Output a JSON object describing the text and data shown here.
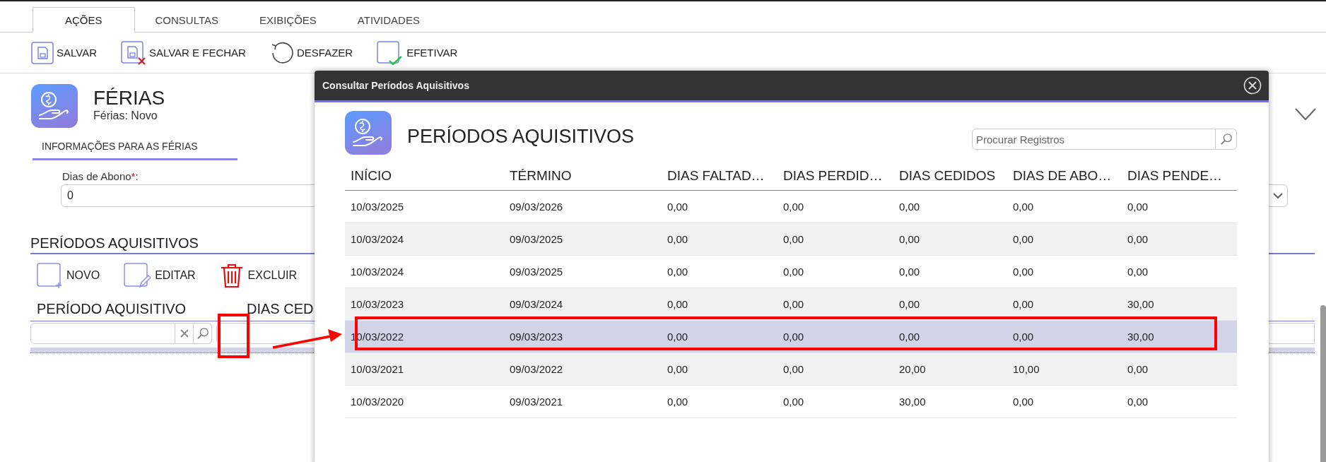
{
  "tabs": [
    {
      "label": "AÇÕES",
      "selected": true
    },
    {
      "label": "CONSULTAS",
      "selected": false
    },
    {
      "label": "EXIBIÇÕES",
      "selected": false
    },
    {
      "label": "ATIVIDADES",
      "selected": false
    }
  ],
  "toolbar": [
    {
      "label": "SALVAR",
      "kind": "save"
    },
    {
      "label": "SALVAR E FECHAR",
      "kind": "save-close"
    },
    {
      "label": "DESFAZER",
      "kind": "undo"
    },
    {
      "label": "EFETIVAR",
      "kind": "confirm"
    }
  ],
  "form": {
    "title": "FÉRIAS",
    "subtitle": "Férias: Novo",
    "section_tab": "INFORMAÇÕES PARA AS FÉRIAS",
    "field": {
      "label": "Dias de Abono",
      "required_mark": "*",
      "colon": ":",
      "value": "0"
    }
  },
  "periods": {
    "title": "PERÍODOS AQUISITIVOS",
    "actions": [
      {
        "label": "NOVO",
        "kind": "new"
      },
      {
        "label": "EDITAR",
        "kind": "edit"
      },
      {
        "label": "EXCLUIR",
        "kind": "delete"
      }
    ],
    "columns": [
      "PERÍODO AQUISITIVO",
      "DIAS CED"
    ]
  },
  "dialog": {
    "title": "Consultar Períodos Aquisitivos",
    "heading": "PERÍODOS AQUISITIVOS",
    "search": {
      "placeholder": "Procurar Registros"
    },
    "columns": [
      "INÍCIO",
      "TÉRMINO",
      "DIAS FALTAD…",
      "DIAS PERDID…",
      "DIAS CEDIDOS",
      "DIAS DE ABO…",
      "DIAS PENDE…"
    ],
    "rows": [
      {
        "cells": [
          "10/03/2025",
          "09/03/2026",
          "0,00",
          "0,00",
          "0,00",
          "0,00",
          "0,00"
        ],
        "selected": false
      },
      {
        "cells": [
          "10/03/2024",
          "09/03/2025",
          "0,00",
          "0,00",
          "0,00",
          "0,00",
          "0,00"
        ],
        "selected": false
      },
      {
        "cells": [
          "10/03/2024",
          "09/03/2025",
          "0,00",
          "0,00",
          "0,00",
          "0,00",
          "0,00"
        ],
        "selected": false
      },
      {
        "cells": [
          "10/03/2023",
          "09/03/2024",
          "0,00",
          "0,00",
          "0,00",
          "0,00",
          "30,00"
        ],
        "selected": false
      },
      {
        "cells": [
          "10/03/2022",
          "09/03/2023",
          "0,00",
          "0,00",
          "0,00",
          "0,00",
          "30,00"
        ],
        "selected": true
      },
      {
        "cells": [
          "10/03/2021",
          "09/03/2022",
          "0,00",
          "0,00",
          "20,00",
          "10,00",
          "0,00"
        ],
        "selected": false
      },
      {
        "cells": [
          "10/03/2020",
          "09/03/2021",
          "0,00",
          "0,00",
          "30,00",
          "0,00",
          "0,00"
        ],
        "selected": false
      }
    ]
  }
}
